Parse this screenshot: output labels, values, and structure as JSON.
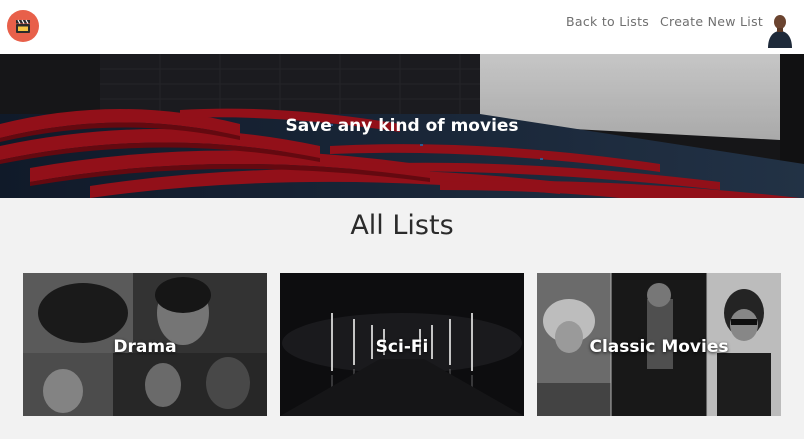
{
  "nav": {
    "logo_icon": "clapperboard-icon",
    "back_label": "Back to Lists",
    "create_label": "Create New List",
    "accent_color": "#e8604a"
  },
  "hero": {
    "title": "Save any kind of movies"
  },
  "main": {
    "section_title": "All Lists",
    "cards": [
      {
        "label": "Drama"
      },
      {
        "label": "Sci-Fi"
      },
      {
        "label": "Classic Movies"
      }
    ]
  }
}
